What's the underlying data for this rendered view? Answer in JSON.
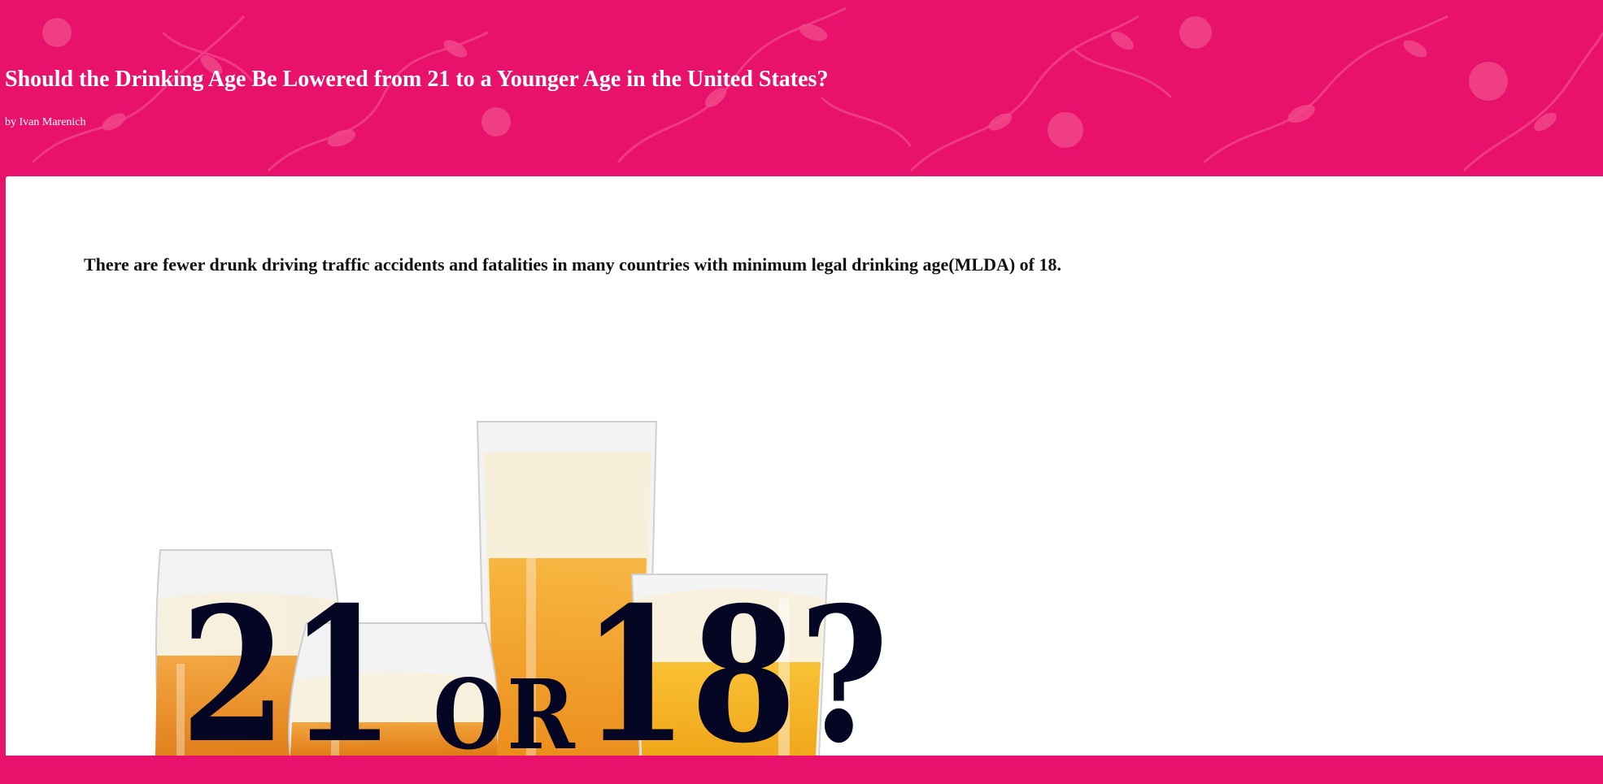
{
  "article": {
    "title": "Should the Drinking Age Be Lowered from 21 to a Younger Age in the United States?",
    "byline": "by Ivan Marenich",
    "lead": "There are fewer drunk driving traffic accidents and fatalities in many countries with minimum legal drinking age(MLDA) of 18."
  },
  "hero": {
    "left_number": "21",
    "connector": "OR",
    "right_number": "18?",
    "image_subject": "beer-glasses"
  },
  "colors": {
    "header_background": "#e8116b",
    "header_pattern": "#f04a8a",
    "card_background": "#ffffff",
    "headline_text": "#050524",
    "title_text": "#ffffff"
  }
}
